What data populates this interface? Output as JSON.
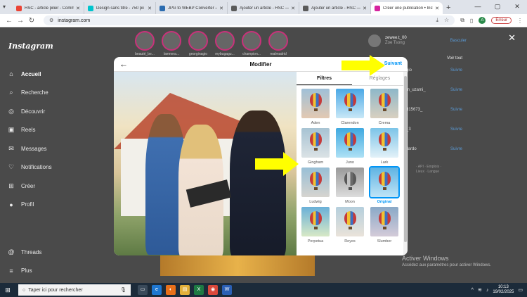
{
  "browser": {
    "tabs": [
      {
        "label": "HSC - article pilier - Comme",
        "color": "#ea4335"
      },
      {
        "label": "Design sans titre - 750 px x",
        "color": "#00c4cc"
      },
      {
        "label": "JPG to WEBP Converter — C",
        "color": "#2b6cb0"
      },
      {
        "label": "Ajouter un article - HSC — W",
        "color": "#5a5a5a"
      },
      {
        "label": "Ajouter un article - HSC — W",
        "color": "#5a5a5a"
      },
      {
        "label": "Créer une publication • Insta",
        "color": "#d6249f"
      }
    ],
    "new_tab": "+",
    "url": "instagram.com",
    "error_label": "Erreur",
    "profile_initial": "A"
  },
  "instagram": {
    "logo": "Instagram",
    "nav": [
      {
        "label": "Accueil",
        "icon": "home-icon",
        "glyph": "⌂"
      },
      {
        "label": "Recherche",
        "icon": "search-icon",
        "glyph": "⌕"
      },
      {
        "label": "Découvrir",
        "icon": "compass-icon",
        "glyph": "◎"
      },
      {
        "label": "Reels",
        "icon": "reels-icon",
        "glyph": "▣"
      },
      {
        "label": "Messages",
        "icon": "messenger-icon",
        "glyph": "✉"
      },
      {
        "label": "Notifications",
        "icon": "heart-icon",
        "glyph": "♡"
      },
      {
        "label": "Créer",
        "icon": "create-icon",
        "glyph": "⊞"
      },
      {
        "label": "Profil",
        "icon": "profile-icon",
        "glyph": "●"
      }
    ],
    "nav_bottom": [
      {
        "label": "Threads",
        "icon": "threads-icon",
        "glyph": "@"
      },
      {
        "label": "Plus",
        "icon": "menu-icon",
        "glyph": "≡"
      }
    ],
    "stories": [
      "beauté_be...",
      "lamnera...",
      "georginagio",
      "mybugagu...",
      "champion...",
      "realmadrid"
    ],
    "account": {
      "username": "zewee.t_00",
      "name": "Zoe Tsong",
      "switch": "Basculer"
    },
    "suggestions_header": "Voir tout",
    "suggestions": [
      {
        "name": "gio",
        "follow": "Suivre"
      },
      {
        "name": "m_uzami_",
        "follow": "Suivre"
      },
      {
        "name": "d15673_",
        "follow": "Suivre"
      },
      {
        "name": "_3",
        "follow": "Suivre"
      },
      {
        "name": "llardo",
        "follow": "Suivre"
      }
    ],
    "footer_lines": [
      "· API · Emplois ·",
      "Lieux · Langue"
    ]
  },
  "modal": {
    "back": "←",
    "title": "Modifier",
    "next": "Suivant",
    "tabs": [
      {
        "label": "Filtres",
        "active": true
      },
      {
        "label": "Réglages",
        "active": false
      }
    ],
    "filters": [
      {
        "name": "Aden",
        "tint": "linear-gradient(180deg,#9fc0d8,#e3c9b2)"
      },
      {
        "name": "Clarendon",
        "tint": "linear-gradient(180deg,#4aa8e6,#c9e8f7)"
      },
      {
        "name": "Crema",
        "tint": "linear-gradient(180deg,#8db7c9,#d9d0c0)"
      },
      {
        "name": "Gingham",
        "tint": "linear-gradient(180deg,#a7c3d3,#dbe2e5)"
      },
      {
        "name": "Juno",
        "tint": "linear-gradient(180deg,#3fa9e0,#aee1f5)"
      },
      {
        "name": "Lark",
        "tint": "linear-gradient(180deg,#7cc4e8,#e3f1f8)"
      },
      {
        "name": "Ludwig",
        "tint": "linear-gradient(180deg,#98bfd6,#d6d4cf)"
      },
      {
        "name": "Moon",
        "tint": "linear-gradient(180deg,#9a9a9a,#dcdcdc)"
      },
      {
        "name": "Original",
        "tint": "linear-gradient(180deg,#5fb3e3,#bfe4f6)",
        "selected": true
      },
      {
        "name": "Perpetua",
        "tint": "linear-gradient(180deg,#6ab0d8,#d8e9c6)"
      },
      {
        "name": "Reyes",
        "tint": "linear-gradient(180deg,#b5cfdd,#eae3da)"
      },
      {
        "name": "Slumber",
        "tint": "linear-gradient(180deg,#8aa9c7,#d4cbd9)"
      }
    ]
  },
  "watermark": {
    "line1": "Activer Windows",
    "line2": "Accédez aux paramètres pour activer Windows."
  },
  "taskbar": {
    "search_placeholder": "Taper ici pour rechercher",
    "time": "10:13",
    "date": "19/02/2025"
  },
  "colors": {
    "accent": "#0095f6",
    "arrow": "#ffff00"
  }
}
